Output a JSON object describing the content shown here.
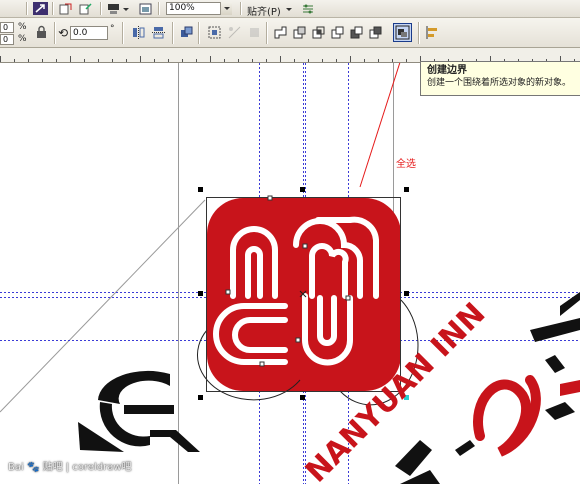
{
  "toolbar": {
    "zoom_level": "100%",
    "snap_label": "贴齐(P)",
    "angle_value": "0.0",
    "angle_unit": "°",
    "left_values": [
      "0",
      "0"
    ],
    "left_units": [
      "%",
      "%"
    ]
  },
  "tooltip": {
    "title": "创建边界",
    "description": "创建一个围绕着所选对象的新对象。"
  },
  "annotation": "全选",
  "canvas": {
    "logo_text": "NANYUAN INN"
  },
  "watermark": "Bai 🐾 贴吧 | coreldraw吧",
  "colors": {
    "logo_red": "#c8141b",
    "guide_blue": "#3b3bd6",
    "annotation_red": "#e51a1a",
    "tooltip_bg": "#ffffe1"
  }
}
